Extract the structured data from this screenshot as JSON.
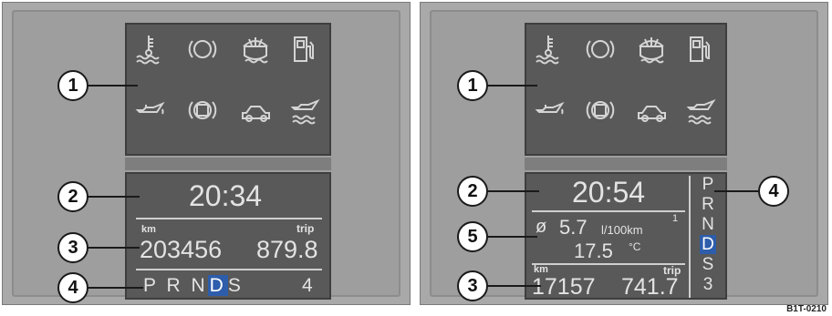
{
  "left_display": {
    "clock": "20:34",
    "odo_unit": "km",
    "trip_label": "trip",
    "odometer": "203456",
    "trip": "879.8",
    "gear_selector": [
      "P",
      "R",
      "N",
      "D",
      "S"
    ],
    "selected_gear": "D",
    "gear_number": "4"
  },
  "right_display": {
    "clock": "20:54",
    "avg_symbol": "ø",
    "consumption": "5.7",
    "consumption_unit": "l/100km",
    "consumption_marker": "1",
    "temperature": "17.5",
    "temperature_unit": "°C",
    "odo_unit": "km",
    "trip_label": "trip",
    "odometer": "17157",
    "trip": "741.7",
    "gear_selector": [
      "P",
      "R",
      "N",
      "D",
      "S",
      "3"
    ],
    "selected_gear": "D"
  },
  "warning_icons": [
    "coolant-temperature-icon",
    "brake-icon",
    "washer-fluid-icon",
    "fuel-icon",
    "oil-pressure-icon",
    "brake-pad-icon",
    "door-open-icon",
    "oil-level-icon"
  ],
  "callouts": {
    "left": [
      "1",
      "2",
      "3",
      "4"
    ],
    "right": [
      "1",
      "2",
      "5",
      "3",
      "4"
    ]
  },
  "figure_id": "B1T-0210",
  "colors": {
    "screen": "#595959",
    "text": "#e3e3e3",
    "highlight": "#2d5dab"
  }
}
